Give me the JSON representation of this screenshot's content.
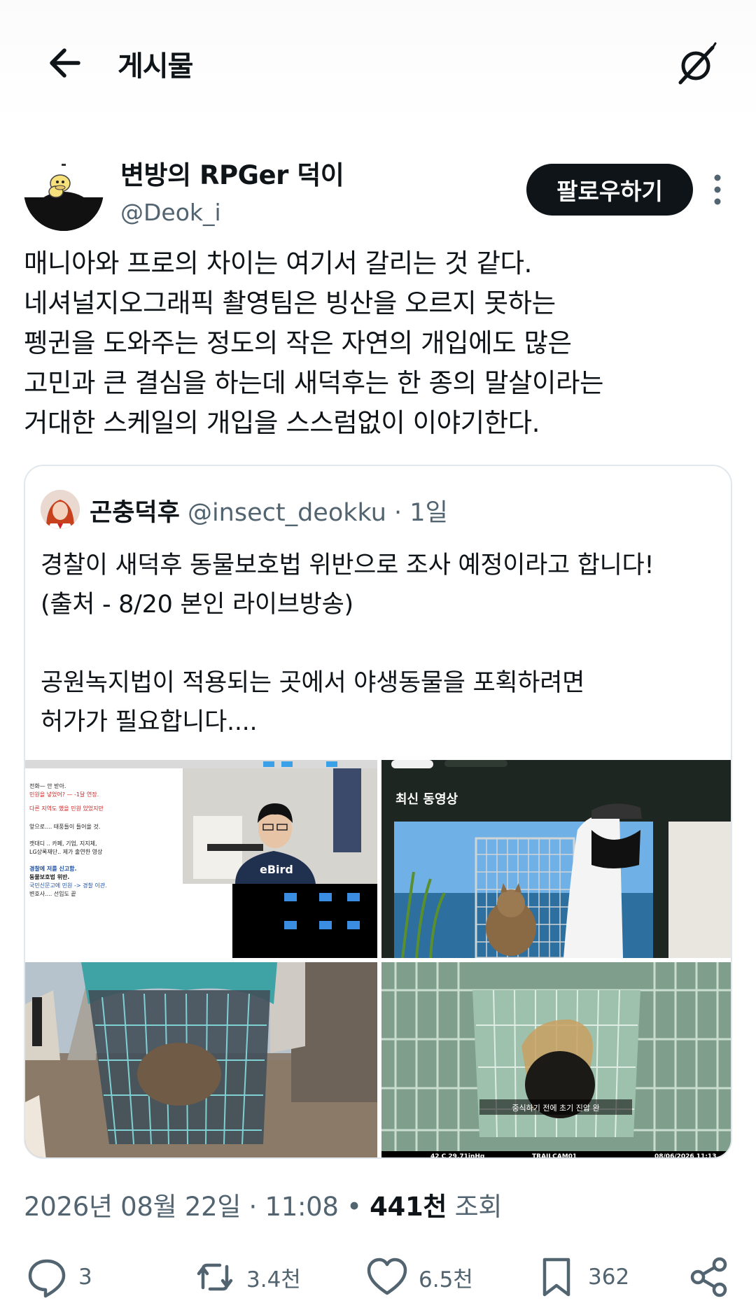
{
  "header": {
    "title": "게시물"
  },
  "author": {
    "name": "변방의 RPGer 덕이",
    "handle": "@Deok_i",
    "follow_label": "팔로우하기"
  },
  "post_lines": [
    "매니아와 프로의 차이는 여기서 갈리는 것 같다.",
    "네셔널지오그래픽 촬영팀은 빙산을 오르지 못하는",
    "펭귄을 도와주는 정도의 작은 자연의 개입에도 많은",
    "고민과 큰 결심을 하는데 새덕후는 한 종의 말살이라는",
    "거대한 스케일의 개입을 스스럼없이 이야기한다."
  ],
  "quote": {
    "name": "곤충덕후",
    "handle": "@insect_deokku",
    "sep": " · ",
    "time": "1일",
    "lines": [
      "경찰이 새덕후 동물보호법 위반으로 조사 예정이라고 합니다!",
      "(출처 - 8/20 본인 라이브방송)",
      "",
      "공원녹지법이 적용되는 곳에서 야생동물을 포획하려면",
      "허가가 필요합니다...."
    ],
    "media": {
      "t1_doc_lines": [
        "전화— 안 받아.",
        "민원을 넣었어? — -1달 연장.",
        "다른 지역도 했을 민원 있었지만",
        "앞으로.... 태풍들이 들어올 것.",
        "캣대디 .. 카페, 기업, 지지체,",
        "LG상록재단.. 제가 출연한 영상",
        "경찰에 저를 신고함.",
        "동물보호법 위반.",
        "국민신문고에 민원 -> 경찰 이관.",
        "변호사.... 선임도 끝"
      ],
      "t1_shirt": "eBird",
      "t2_title": "최신 동영상",
      "t4_caption": "중식하기 전에 초기 진압 완",
      "t4_bar": [
        "42 C  29.71inHg",
        "TRAILCAM01",
        "08/06/2026 11:13"
      ]
    }
  },
  "meta": {
    "date": "2026년 08월 22일",
    "dot": " · ",
    "time": "11:08",
    "bullet": " • ",
    "views": "441천",
    "views_label": " 조회"
  },
  "actions": {
    "reply": "3",
    "retweet": "3.4천",
    "like": "6.5천",
    "bookmark": "362"
  }
}
